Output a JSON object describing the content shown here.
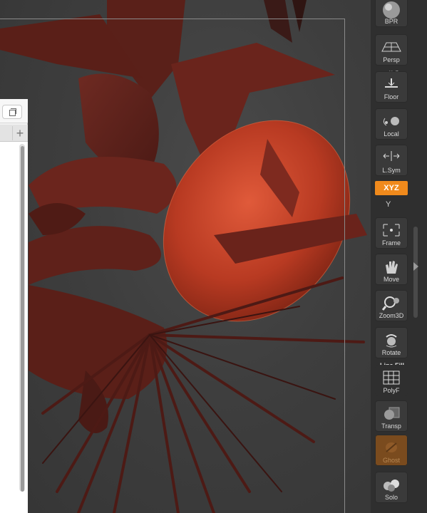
{
  "toolbar": {
    "bpr_label": "BPR",
    "persp_label": "Persp",
    "floor_label": "Floor",
    "floor_axes": "Y Z",
    "local_label": "Local",
    "lsym_label": "L.Sym",
    "xyz_label": "XYZ",
    "y_label": "Y",
    "frame_label": "Frame",
    "move_label": "Move",
    "zoom3d_label": "Zoom3D",
    "rotate_label": "Rotate",
    "linefill_label": "Line Fill",
    "polyf_label": "PolyF",
    "transp_label": "Transp",
    "ghost_label": "Ghost",
    "solo_label": "Solo"
  },
  "side_panel": {
    "add_tab_symbol": "+"
  },
  "colors": {
    "accent_orange": "#f08a1c",
    "model_red": "#7a2b1e",
    "ghost_active": "#7a4b1e",
    "viewport_bg": "#3e3e3e"
  }
}
